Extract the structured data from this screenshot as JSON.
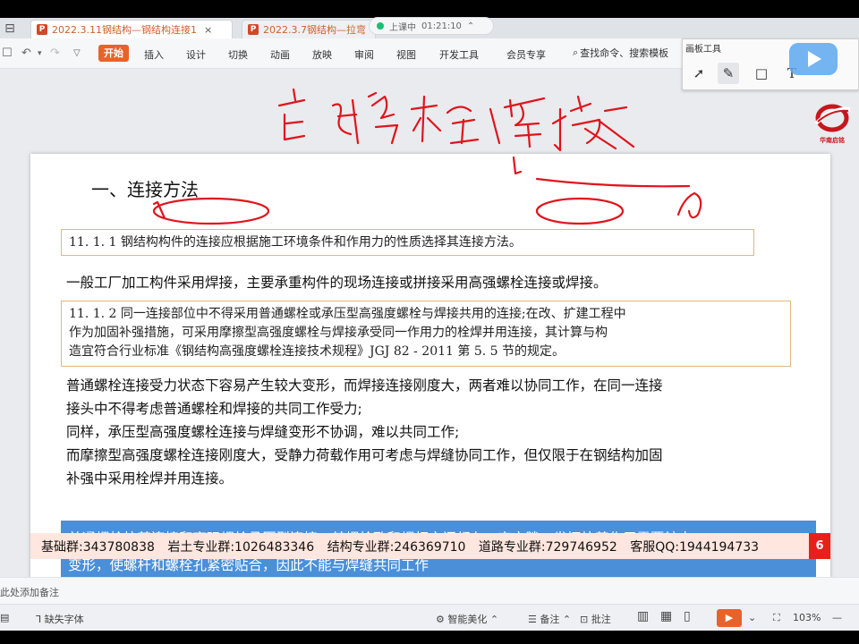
{
  "tabs": [
    {
      "label": "2022.3.11钢结构—钢结构连接1"
    },
    {
      "label": "2022.3.7钢结构—拉弯"
    }
  ],
  "class_status": {
    "label": "上课中",
    "time": "01:21:10"
  },
  "ribbon": {
    "menus": [
      "开始",
      "插入",
      "设计",
      "切换",
      "动画",
      "放映",
      "审阅",
      "视图",
      "开发工具",
      "会员专享"
    ],
    "search": "查找命令、搜索模板"
  },
  "draw_panel": {
    "title": "画板工具"
  },
  "slide": {
    "title": "一、连接方法",
    "std1": "11. 1. 1 钢结构构件的连接应根据施工环境条件和作用力的性质选择其连接方法。",
    "general_line": "一般工厂加工构件采用焊接，主要承重构件的现场连接或拼接采用高强螺栓连接或焊接。",
    "std2_lines": [
      "11. 1. 2 同一连接部位中不得采用普通螺栓或承压型高强度螺栓与焊接共用的连接;在改、扩建工程中",
      "作为加固补强措施，可采用摩擦型高强度螺栓与焊接承受同一作用力的栓焊并用连接，其计算与构",
      "造宜符合行业标准《钢结构高强度螺栓连接技术规程》JGJ 82 - 2011 第 5. 5 节的规定。"
    ],
    "explain_lines": [
      "普通螺栓连接受力状态下容易产生较大变形，而焊接连接刚度大，两者难以协同工作，在同一连接",
      "接头中不得考虑普通螺栓和焊接的共同工作受力;",
      "同样，承压型高强度螺栓连接与焊缝变形不协调，难以共同工作;",
      "而摩擦型高强度螺栓连接刚度大，受静力荷载作用可考虑与焊缝协同工作，但仅限于在钢结构加固",
      "补强中采用栓焊并用连接。"
    ],
    "blue_lines": [
      "普通螺栓抗剪连接和高强螺栓承压型连接，其螺栓孔和螺杆之间都有一定空隙，发挥抗剪作用需要较大",
      "变形，使螺杆和螺栓孔紧密贴合，因此不能与焊缝共同工作"
    ],
    "logo_text": "华南启铭",
    "contact": "基础群:343780838 岩土专业群:1026483346 结构专业群:246369710 道路专业群:729746952 客服QQ:1944194733",
    "page_number": "6"
  },
  "notes": {
    "placeholder": "此处添加备注"
  },
  "status": {
    "missing_font": "缺失字体",
    "beautify": "智能美化",
    "notes": "备注",
    "annotate": "批注",
    "zoom": "103%"
  },
  "colors": {
    "accent": "#e8632b",
    "blue_box": "#4a8fd8",
    "ink": "#e0141c",
    "std_border": "#e0b87a"
  }
}
